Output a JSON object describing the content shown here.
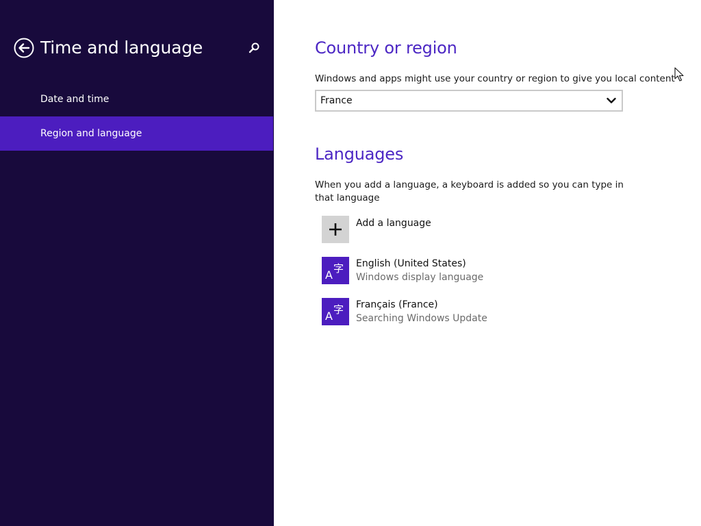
{
  "sidebar": {
    "title": "Time and language",
    "back_icon": "back-arrow-icon",
    "search_icon": "search-icon",
    "items": [
      {
        "label": "Date and time",
        "selected": false
      },
      {
        "label": "Region and language",
        "selected": true
      }
    ]
  },
  "country": {
    "title": "Country or region",
    "description": "Windows and apps might use your country or region to give you local content",
    "selected": "France"
  },
  "languages": {
    "title": "Languages",
    "description": "When you add a language, a keyboard is added so you can type in that language",
    "add_label": "Add a language",
    "items": [
      {
        "name": "English (United States)",
        "status": "Windows display language",
        "icon": "language-icon"
      },
      {
        "name": "Français (France)",
        "status": "Searching Windows Update",
        "icon": "language-icon"
      }
    ]
  },
  "colors": {
    "sidebar_bg": "#180a3c",
    "accent": "#4c1dbf",
    "heading": "#4c27c4"
  }
}
